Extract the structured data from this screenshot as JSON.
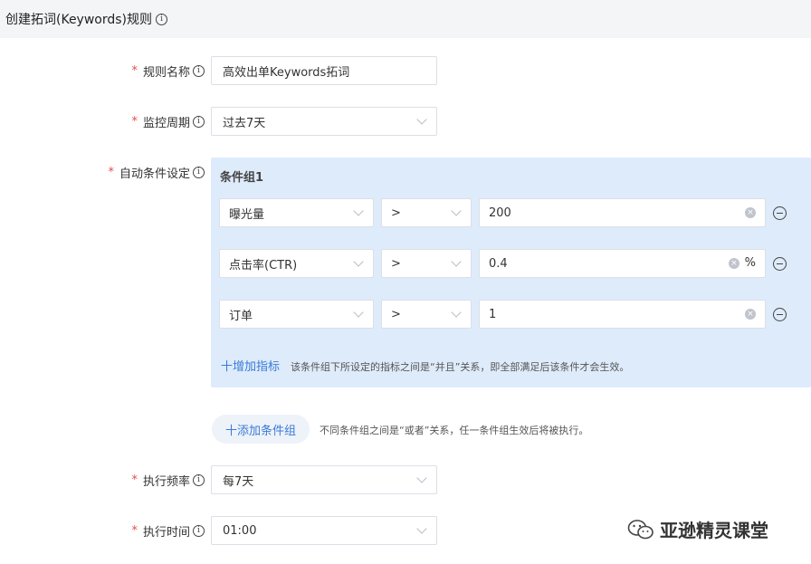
{
  "header": {
    "title": "创建拓词(Keywords)规则"
  },
  "form": {
    "rule_name": {
      "label": "规则名称",
      "value": "高效出单Keywords拓词"
    },
    "period": {
      "label": "监控周期",
      "value": "过去7天"
    },
    "conditions": {
      "label": "自动条件设定",
      "group_title": "条件组1",
      "rows": [
        {
          "metric": "曝光量",
          "operator": ">",
          "value": "200",
          "unit": ""
        },
        {
          "metric": "点击率(CTR)",
          "operator": ">",
          "value": "0.4",
          "unit": "%"
        },
        {
          "metric": "订单",
          "operator": ">",
          "value": "1",
          "unit": ""
        }
      ],
      "add_metric": "十增加指标",
      "add_metric_hint": "该条件组下所设定的指标之间是“并且”关系，即全部满足后该条件才会生效。"
    },
    "add_group": {
      "label": "十添加条件组",
      "hint": "不同条件组之间是“或者”关系，任一条件组生效后将被执行。"
    },
    "frequency": {
      "label": "执行频率",
      "value": "每7天"
    },
    "exec_time": {
      "label": "执行时间",
      "value": "01:00"
    }
  },
  "watermark": {
    "text": "亚逊精灵课堂",
    "icon": "wechat-icon"
  }
}
